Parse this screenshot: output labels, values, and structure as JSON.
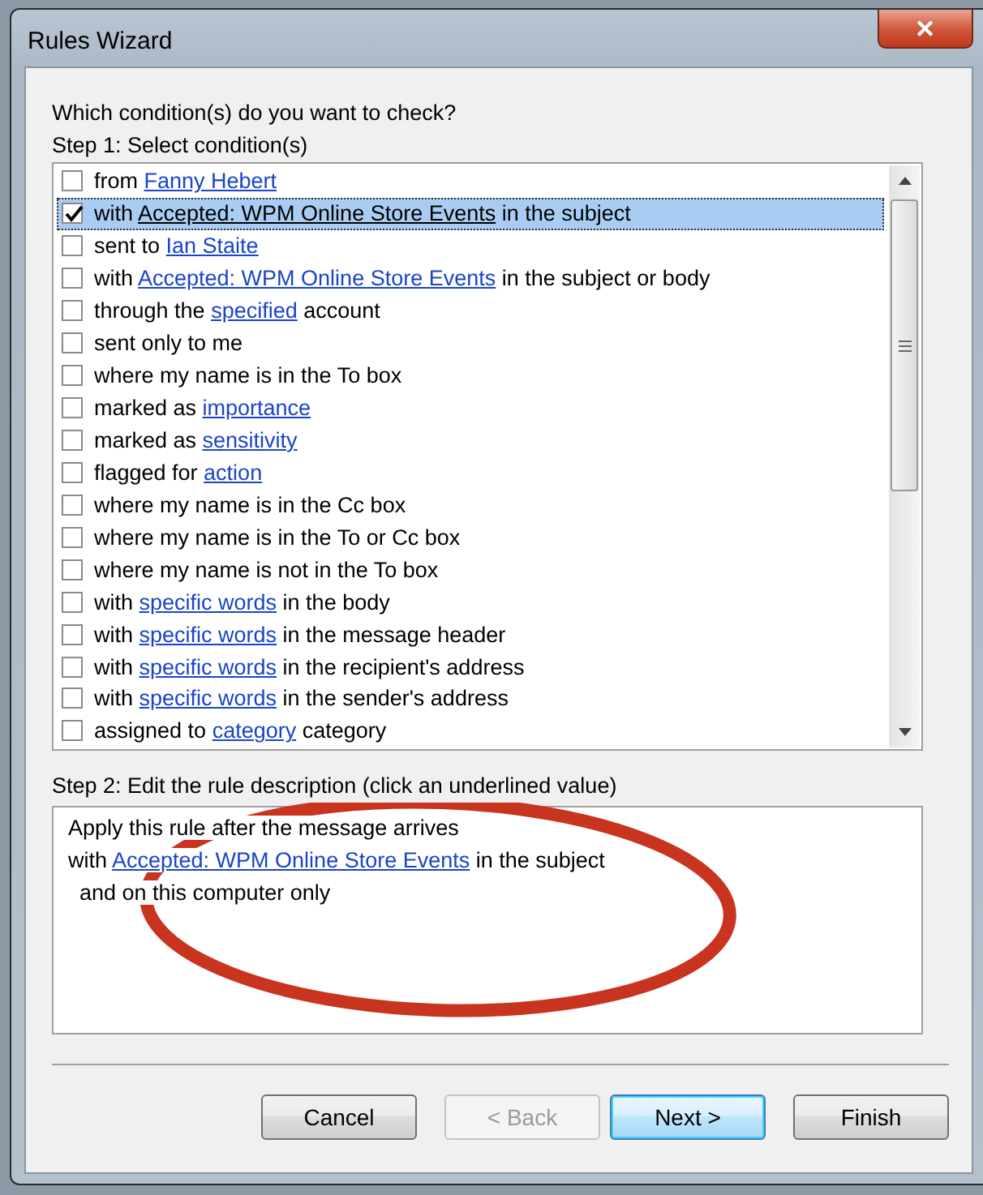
{
  "window": {
    "title": "Rules Wizard",
    "close_glyph": "✕"
  },
  "prompt": "Which condition(s) do you want to check?",
  "step1_label": "Step 1: Select condition(s)",
  "conditions": [
    {
      "checked": false,
      "selected": false,
      "parts": [
        {
          "kind": "text",
          "text": "from "
        },
        {
          "kind": "link",
          "text": "Fanny Hebert"
        }
      ]
    },
    {
      "checked": true,
      "selected": true,
      "parts": [
        {
          "kind": "text",
          "text": "with "
        },
        {
          "kind": "link",
          "text": "Accepted: WPM Online Store Events"
        },
        {
          "kind": "text",
          "text": " in the subject"
        }
      ]
    },
    {
      "checked": false,
      "selected": false,
      "parts": [
        {
          "kind": "text",
          "text": "sent to "
        },
        {
          "kind": "link",
          "text": "Ian Staite"
        }
      ]
    },
    {
      "checked": false,
      "selected": false,
      "parts": [
        {
          "kind": "text",
          "text": "with "
        },
        {
          "kind": "link",
          "text": "Accepted: WPM Online Store Events"
        },
        {
          "kind": "text",
          "text": " in the subject or body"
        }
      ]
    },
    {
      "checked": false,
      "selected": false,
      "parts": [
        {
          "kind": "text",
          "text": "through the "
        },
        {
          "kind": "link",
          "text": "specified"
        },
        {
          "kind": "text",
          "text": " account"
        }
      ]
    },
    {
      "checked": false,
      "selected": false,
      "parts": [
        {
          "kind": "text",
          "text": "sent only to me"
        }
      ]
    },
    {
      "checked": false,
      "selected": false,
      "parts": [
        {
          "kind": "text",
          "text": "where my name is in the To box"
        }
      ]
    },
    {
      "checked": false,
      "selected": false,
      "parts": [
        {
          "kind": "text",
          "text": "marked as "
        },
        {
          "kind": "link",
          "text": "importance"
        }
      ]
    },
    {
      "checked": false,
      "selected": false,
      "parts": [
        {
          "kind": "text",
          "text": "marked as "
        },
        {
          "kind": "link",
          "text": "sensitivity"
        }
      ]
    },
    {
      "checked": false,
      "selected": false,
      "parts": [
        {
          "kind": "text",
          "text": "flagged for "
        },
        {
          "kind": "link",
          "text": "action"
        }
      ]
    },
    {
      "checked": false,
      "selected": false,
      "parts": [
        {
          "kind": "text",
          "text": "where my name is in the Cc box"
        }
      ]
    },
    {
      "checked": false,
      "selected": false,
      "parts": [
        {
          "kind": "text",
          "text": "where my name is in the To or Cc box"
        }
      ]
    },
    {
      "checked": false,
      "selected": false,
      "parts": [
        {
          "kind": "text",
          "text": "where my name is not in the To box"
        }
      ]
    },
    {
      "checked": false,
      "selected": false,
      "parts": [
        {
          "kind": "text",
          "text": "with "
        },
        {
          "kind": "link",
          "text": "specific words"
        },
        {
          "kind": "text",
          "text": " in the body"
        }
      ]
    },
    {
      "checked": false,
      "selected": false,
      "parts": [
        {
          "kind": "text",
          "text": "with "
        },
        {
          "kind": "link",
          "text": "specific words"
        },
        {
          "kind": "text",
          "text": " in the message header"
        }
      ]
    },
    {
      "checked": false,
      "selected": false,
      "parts": [
        {
          "kind": "text",
          "text": "with "
        },
        {
          "kind": "link",
          "text": "specific words"
        },
        {
          "kind": "text",
          "text": " in the recipient's address"
        }
      ]
    },
    {
      "checked": false,
      "selected": false,
      "parts": [
        {
          "kind": "text",
          "text": "with "
        },
        {
          "kind": "link",
          "text": "specific words"
        },
        {
          "kind": "text",
          "text": " in the sender's address"
        }
      ]
    },
    {
      "checked": false,
      "selected": false,
      "parts": [
        {
          "kind": "text",
          "text": "assigned to "
        },
        {
          "kind": "link",
          "text": "category"
        },
        {
          "kind": "text",
          "text": " category"
        }
      ]
    }
  ],
  "step2_label": "Step 2: Edit the rule description (click an underlined value)",
  "description": [
    {
      "indent": false,
      "parts": [
        {
          "kind": "text",
          "text": "Apply this rule after the message arrives"
        }
      ]
    },
    {
      "indent": false,
      "parts": [
        {
          "kind": "text",
          "text": "with "
        },
        {
          "kind": "link",
          "text": "Accepted: WPM Online Store Events"
        },
        {
          "kind": "text",
          "text": " in the subject"
        }
      ]
    },
    {
      "indent": true,
      "parts": [
        {
          "kind": "text",
          "text": "and on this computer only"
        }
      ]
    }
  ],
  "buttons": [
    {
      "label": "Cancel",
      "disabled": false,
      "default": false
    },
    {
      "label": "< Back",
      "disabled": true,
      "default": false
    },
    {
      "label": "Next >",
      "disabled": false,
      "default": true
    },
    {
      "label": "Finish",
      "disabled": false,
      "default": false
    }
  ]
}
